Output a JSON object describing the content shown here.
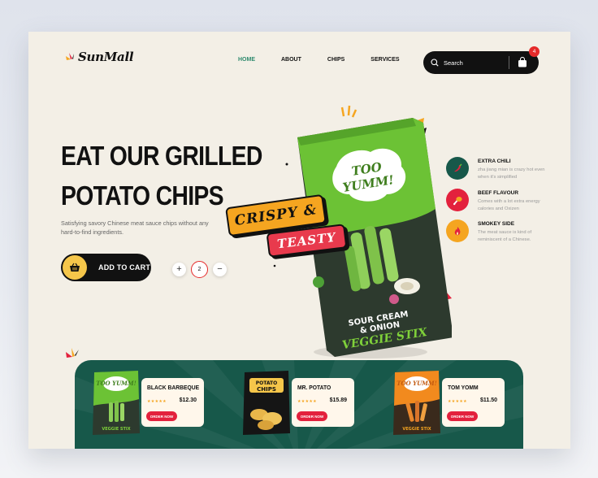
{
  "brand": {
    "name": "SunMall"
  },
  "nav": {
    "items": [
      {
        "label": "HOME",
        "active": true
      },
      {
        "label": "ABOUT",
        "active": false
      },
      {
        "label": "CHIPS",
        "active": false
      },
      {
        "label": "SERVICES",
        "active": false
      }
    ]
  },
  "search": {
    "placeholder": "Search",
    "icon": "search-icon"
  },
  "cart": {
    "count": "4",
    "icon": "shopping-bag-icon"
  },
  "hero": {
    "headline_line1": "EAT OUR GRILLED",
    "headline_line2": "POTATO CHIPS",
    "subtext": "Satisfying savory Chinese meat sauce chips without any hard-to-find ingredients.",
    "add_to_cart": "ADD TO CART",
    "quantity": "2",
    "minus": "−",
    "plus": "+"
  },
  "product_bag": {
    "brand_line1": "TOO",
    "brand_line2": "YUMM!",
    "flavor_line1": "SOUR CREAM",
    "flavor_line2": "& ONION",
    "product": "VEGGIE STIX",
    "badge1": "CRISPY &",
    "badge2": "TEASTY"
  },
  "features": [
    {
      "title": "EXTRA CHILI",
      "desc": "zha jiang mian is crazy hot even when it's simplified",
      "color": "#17584a",
      "icon": "chili-icon"
    },
    {
      "title": "BEEF FLAVOUR",
      "desc": "Comes with a lot extra energy calories and Oxizen",
      "color": "#e3213d",
      "icon": "drumstick-icon"
    },
    {
      "title": "SMOKEY SIDE",
      "desc": "The meat sauce is kind of reminiscent of a Chinese.",
      "color": "#f5a520",
      "icon": "flame-icon"
    }
  ],
  "products": [
    {
      "name": "BLACK BARBEQUE",
      "price": "$12.30",
      "stars": "★★★★★",
      "button": "ORDER NOW",
      "pack": "green"
    },
    {
      "name": "MR. POTATO",
      "price": "$15.89",
      "stars": "★★★★★",
      "button": "ORDER NOW",
      "pack": "black"
    },
    {
      "name": "TOM YOMM",
      "price": "$11.50",
      "stars": "★★★★★",
      "button": "ORDER NOW",
      "pack": "orange"
    }
  ],
  "colors": {
    "accent_green": "#2f8a6e",
    "panel": "#17584a",
    "red": "#e3213d",
    "yellow": "#f5c64a",
    "bg": "#f3efe6"
  }
}
